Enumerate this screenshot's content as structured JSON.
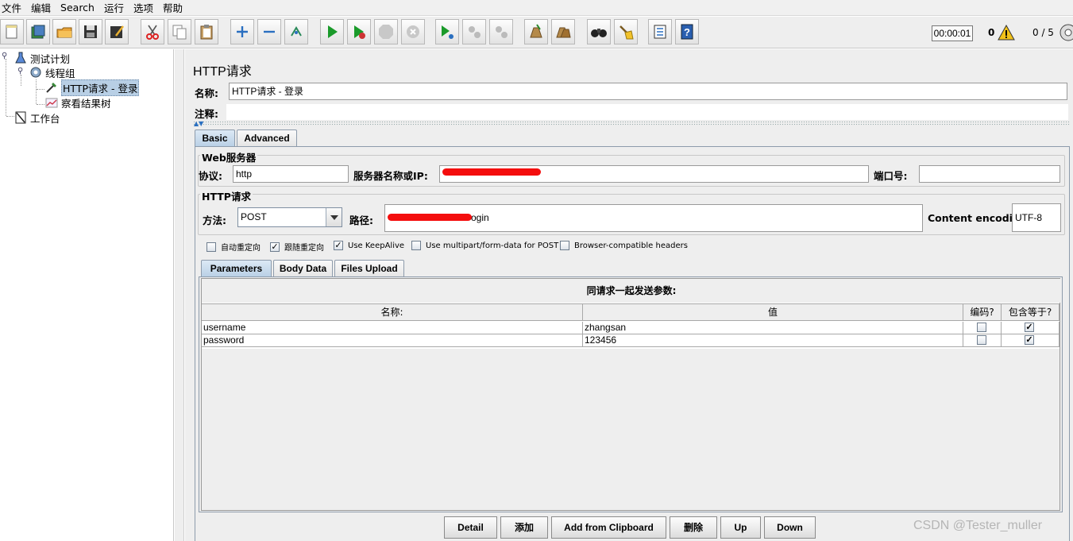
{
  "menu": [
    "文件",
    "编辑",
    "Search",
    "运行",
    "选项",
    "帮助"
  ],
  "toolbar": {
    "timer": "00:00:01",
    "warning_count": "0",
    "threads": "0 / 5",
    "icons": [
      "new-icon",
      "templates-icon",
      "open-icon",
      "save-icon",
      "save-as-icon",
      "cut-icon",
      "copy-icon",
      "paste-icon",
      "expand-icon",
      "collapse-icon",
      "toggle-icon",
      "start-icon",
      "start-no-pause-icon",
      "stop-icon",
      "shutdown-icon",
      "remote-start-icon",
      "remote-stop-icon",
      "remote-shutdown-icon",
      "clear-icon",
      "clear-all-icon",
      "search-icon",
      "reset-search-icon",
      "function-helper-icon",
      "help-icon"
    ]
  },
  "tree": {
    "test_plan": "测试计划",
    "thread_group": "线程组",
    "http_request": "HTTP请求 - 登录",
    "results_tree": "察看结果树",
    "workbench": "工作台"
  },
  "panel": {
    "title": "HTTP请求",
    "name_label": "名称:",
    "name_value": "HTTP请求 - 登录",
    "comment_label": "注释:",
    "comment_value": ""
  },
  "tabs": {
    "basic": "Basic",
    "advanced": "Advanced"
  },
  "web_server": {
    "title": "Web服务器",
    "protocol_label": "协议:",
    "protocol_value": "http",
    "server_label": "服务器名称或IP:",
    "server_value": "",
    "port_label": "端口号:",
    "port_value": ""
  },
  "http_request": {
    "title": "HTTP请求",
    "method_label": "方法:",
    "method_value": "POST",
    "path_label": "路径:",
    "path_value": "ogin",
    "encoding_label": "Content encoding:",
    "encoding_value": "UTF-8"
  },
  "options": [
    {
      "label": "自动重定向",
      "checked": false
    },
    {
      "label": "跟随重定向",
      "checked": true
    },
    {
      "label": "Use KeepAlive",
      "checked": true
    },
    {
      "label": "Use multipart/form-data for POST",
      "checked": false
    },
    {
      "label": "Browser-compatible headers",
      "checked": false
    }
  ],
  "subtabs": {
    "parameters": "Parameters",
    "body": "Body Data",
    "files": "Files Upload"
  },
  "params_table": {
    "caption": "同请求一起发送参数:",
    "headers": [
      "名称:",
      "值",
      "编码?",
      "包含等于?"
    ],
    "rows": [
      {
        "name": "username",
        "value": "zhangsan",
        "encode": false,
        "include_equals": true
      },
      {
        "name": "password",
        "value": "123456",
        "encode": false,
        "include_equals": true
      }
    ]
  },
  "buttons": {
    "detail": "Detail",
    "add": "添加",
    "add_clipboard": "Add from Clipboard",
    "delete": "删除",
    "up": "Up",
    "down": "Down"
  },
  "watermark": "CSDN @Tester_muller",
  "colors": {
    "selection": "#b8cfe5",
    "redaction": "#f40e0e",
    "tab_active": "#b8cfe5"
  }
}
